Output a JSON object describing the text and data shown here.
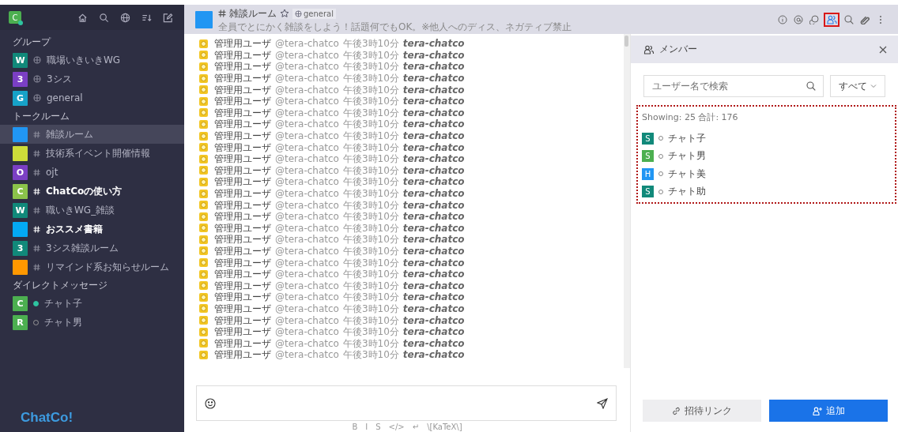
{
  "sidebar": {
    "user_avatar": {
      "letter": "C",
      "color": "#4caf50",
      "online": true
    },
    "sections": [
      {
        "title": "グループ",
        "items": [
          {
            "kind": "group",
            "letter": "W",
            "color": "#11897a",
            "label": "職場いきいきWG",
            "selected": false,
            "unread": false
          },
          {
            "kind": "group",
            "letter": "3",
            "color": "#7b3fc4",
            "label": "3シス",
            "selected": false,
            "unread": false
          },
          {
            "kind": "group",
            "letter": "G",
            "color": "#17a2c8",
            "label": "general",
            "selected": false,
            "unread": false
          }
        ]
      },
      {
        "title": "トークルーム",
        "items": [
          {
            "kind": "room",
            "color": "#2196f3",
            "label": "雑談ルーム",
            "selected": true,
            "unread": false
          },
          {
            "kind": "room",
            "color": "#cddc39",
            "label": "技術系イベント開催情報",
            "selected": false,
            "unread": false
          },
          {
            "kind": "room",
            "letter": "O",
            "color": "#7b3fc4",
            "label": "ojt",
            "selected": false,
            "unread": false
          },
          {
            "kind": "room",
            "letter": "C",
            "color": "#8bc34a",
            "label": "ChatCoの使い方",
            "selected": false,
            "unread": true
          },
          {
            "kind": "room",
            "letter": "W",
            "color": "#11897a",
            "label": "職いきWG_雑談",
            "selected": false,
            "unread": false
          },
          {
            "kind": "room",
            "color": "#03a9f4",
            "label": "おススメ書籍",
            "selected": false,
            "unread": true
          },
          {
            "kind": "room",
            "letter": "3",
            "color": "#11897a",
            "label": "3シス雑談ルーム",
            "selected": false,
            "unread": false
          },
          {
            "kind": "room",
            "color": "#ff9800",
            "label": "リマインド系お知らせルーム",
            "selected": false,
            "unread": false
          }
        ]
      },
      {
        "title": "ダイレクトメッセージ",
        "items": [
          {
            "kind": "direct",
            "letter": "C",
            "color": "#4caf50",
            "label": "チャト子",
            "online": true,
            "selected": false,
            "unread": false
          },
          {
            "kind": "direct",
            "letter": "R",
            "color": "#4caf50",
            "label": "チャト男",
            "online": false,
            "selected": false,
            "unread": false
          }
        ]
      }
    ],
    "logo": "ChatCo!"
  },
  "room": {
    "color": "#2196f3",
    "name": "雑談ルーム",
    "starred": false,
    "group": "general",
    "topic": "全員でとにかく雑談をしよう！話題何でもOK。※他人へのディス、ネガティブ禁止"
  },
  "toolbar": [
    {
      "kind": "info",
      "selected": false
    },
    {
      "kind": "mention",
      "selected": false
    },
    {
      "kind": "discussion",
      "selected": false
    },
    {
      "kind": "members",
      "selected": true
    },
    {
      "kind": "search",
      "selected": false
    },
    {
      "kind": "attach",
      "selected": false
    },
    {
      "kind": "more",
      "selected": false
    }
  ],
  "messages": [
    {
      "name": "管理用ユーザ",
      "handle": "@tera-chatco",
      "time": "午後3時10分",
      "username": "tera-chatco"
    },
    {
      "name": "管理用ユーザ",
      "handle": "@tera-chatco",
      "time": "午後3時10分",
      "username": "tera-chatco"
    },
    {
      "name": "管理用ユーザ",
      "handle": "@tera-chatco",
      "time": "午後3時10分",
      "username": "tera-chatco"
    },
    {
      "name": "管理用ユーザ",
      "handle": "@tera-chatco",
      "time": "午後3時10分",
      "username": "tera-chatco"
    },
    {
      "name": "管理用ユーザ",
      "handle": "@tera-chatco",
      "time": "午後3時10分",
      "username": "tera-chatco"
    },
    {
      "name": "管理用ユーザ",
      "handle": "@tera-chatco",
      "time": "午後3時10分",
      "username": "tera-chatco"
    },
    {
      "name": "管理用ユーザ",
      "handle": "@tera-chatco",
      "time": "午後3時10分",
      "username": "tera-chatco"
    },
    {
      "name": "管理用ユーザ",
      "handle": "@tera-chatco",
      "time": "午後3時10分",
      "username": "tera-chatco"
    },
    {
      "name": "管理用ユーザ",
      "handle": "@tera-chatco",
      "time": "午後3時10分",
      "username": "tera-chatco"
    },
    {
      "name": "管理用ユーザ",
      "handle": "@tera-chatco",
      "time": "午後3時10分",
      "username": "tera-chatco"
    },
    {
      "name": "管理用ユーザ",
      "handle": "@tera-chatco",
      "time": "午後3時10分",
      "username": "tera-chatco"
    },
    {
      "name": "管理用ユーザ",
      "handle": "@tera-chatco",
      "time": "午後3時10分",
      "username": "tera-chatco"
    },
    {
      "name": "管理用ユーザ",
      "handle": "@tera-chatco",
      "time": "午後3時10分",
      "username": "tera-chatco"
    },
    {
      "name": "管理用ユーザ",
      "handle": "@tera-chatco",
      "time": "午後3時10分",
      "username": "tera-chatco"
    },
    {
      "name": "管理用ユーザ",
      "handle": "@tera-chatco",
      "time": "午後3時10分",
      "username": "tera-chatco"
    },
    {
      "name": "管理用ユーザ",
      "handle": "@tera-chatco",
      "time": "午後3時10分",
      "username": "tera-chatco"
    },
    {
      "name": "管理用ユーザ",
      "handle": "@tera-chatco",
      "time": "午後3時10分",
      "username": "tera-chatco"
    },
    {
      "name": "管理用ユーザ",
      "handle": "@tera-chatco",
      "time": "午後3時10分",
      "username": "tera-chatco"
    },
    {
      "name": "管理用ユーザ",
      "handle": "@tera-chatco",
      "time": "午後3時10分",
      "username": "tera-chatco"
    },
    {
      "name": "管理用ユーザ",
      "handle": "@tera-chatco",
      "time": "午後3時10分",
      "username": "tera-chatco"
    },
    {
      "name": "管理用ユーザ",
      "handle": "@tera-chatco",
      "time": "午後3時10分",
      "username": "tera-chatco"
    },
    {
      "name": "管理用ユーザ",
      "handle": "@tera-chatco",
      "time": "午後3時10分",
      "username": "tera-chatco"
    },
    {
      "name": "管理用ユーザ",
      "handle": "@tera-chatco",
      "time": "午後3時10分",
      "username": "tera-chatco"
    },
    {
      "name": "管理用ユーザ",
      "handle": "@tera-chatco",
      "time": "午後3時10分",
      "username": "tera-chatco"
    },
    {
      "name": "管理用ユーザ",
      "handle": "@tera-chatco",
      "time": "午後3時10分",
      "username": "tera-chatco"
    },
    {
      "name": "管理用ユーザ",
      "handle": "@tera-chatco",
      "time": "午後3時10分",
      "username": "tera-chatco"
    },
    {
      "name": "管理用ユーザ",
      "handle": "@tera-chatco",
      "time": "午後3時10分",
      "username": "tera-chatco"
    },
    {
      "name": "管理用ユーザ",
      "handle": "@tera-chatco",
      "time": "午後3時10分",
      "username": "tera-chatco"
    }
  ],
  "composer": {
    "format_keys": [
      "B",
      "I",
      "S",
      "</>",
      "↵",
      "\\[KaTeX\\]"
    ]
  },
  "members_panel": {
    "title": "メンバー",
    "search": {
      "placeholder": "ユーザー名で検索"
    },
    "filter": "すべて",
    "summary": "Showing: 25  合計: 176",
    "members": [
      {
        "letter": "S",
        "color": "#11897a",
        "name": "チャト子",
        "online": false
      },
      {
        "letter": "S",
        "color": "#4caf50",
        "name": "チャト男",
        "online": false
      },
      {
        "letter": "H",
        "color": "#2196f3",
        "name": "チャト美",
        "online": false
      },
      {
        "letter": "S",
        "color": "#11897a",
        "name": "チャト助",
        "online": false
      }
    ],
    "buttons": [
      {
        "kind": "invite",
        "label": "招待リンク"
      },
      {
        "kind": "add",
        "label": "追加"
      }
    ]
  }
}
